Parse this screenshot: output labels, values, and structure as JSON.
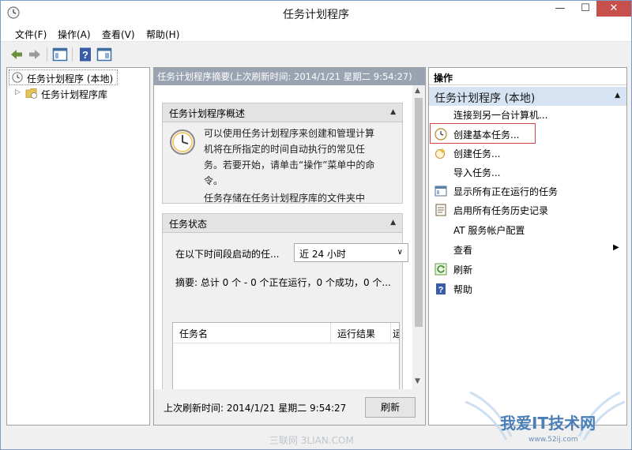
{
  "window": {
    "title": "任务计划程序",
    "min_label": "—",
    "max_label": "☐",
    "close_label": "✕"
  },
  "menubar": {
    "items": [
      "文件(F)",
      "操作(A)",
      "查看(V)",
      "帮助(H)"
    ]
  },
  "left_pane": {
    "root_label": "任务计划程序 (本地)",
    "child_label": "任务计划程序库"
  },
  "middle": {
    "header": "任务计划程序摘要(上次刷新时间: 2014/1/21 星期二 9:54:27)",
    "overview": {
      "title": "任务计划程序概述",
      "text": "可以使用任务计划程序来创建和管理计算机将在所指定的时间自动执行的常见任务。若要开始，请单击“操作”菜单中的命令。",
      "text2": "任务存储在任务计划程序库的文件夹中"
    },
    "status": {
      "title": "任务状态",
      "filter_label": "在以下时间段启动的任...",
      "filter_value": "近 24 小时",
      "summary": "摘要: 总计 0 个 - 0 个正在运行，0 个成功，0 个...",
      "columns": [
        "任务名",
        "运行结果",
        "运"
      ]
    },
    "footer": {
      "last_refresh": "上次刷新时间: 2014/1/21 星期二 9:54:27",
      "refresh_button": "刷新"
    }
  },
  "actions": {
    "header": "操作",
    "group": "任务计划程序 (本地)",
    "items": [
      "连接到另一台计算机...",
      "创建基本任务...",
      "创建任务...",
      "导入任务...",
      "显示所有正在运行的任务",
      "启用所有任务历史记录",
      "AT 服务帐户配置",
      "查看",
      "刷新",
      "帮助"
    ]
  },
  "watermark": {
    "text": "三联网 3LIAN.COM",
    "logo_text": "我爱IT技术网",
    "logo_url": "www.52ij.com"
  },
  "colors": {
    "selection_box": "#d64545",
    "group_bg": "#d5e3f3",
    "header_bg": "#9aa3b2"
  }
}
